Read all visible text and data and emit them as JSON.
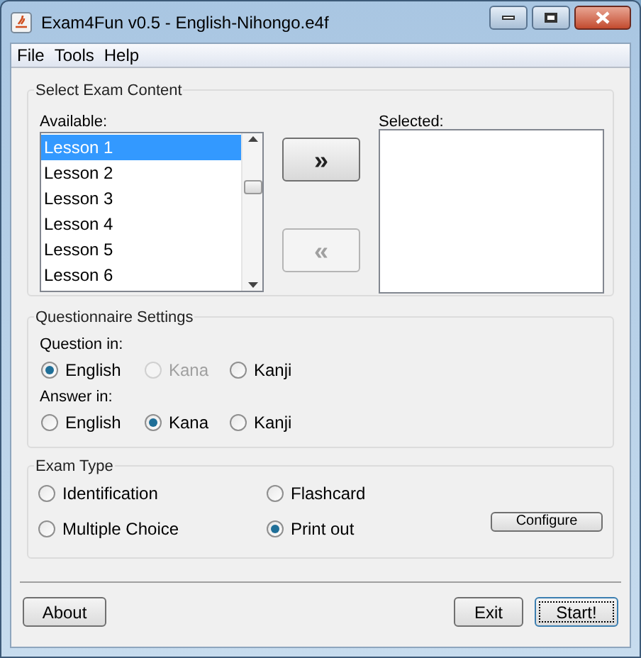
{
  "window": {
    "title": "Exam4Fun v0.5 - English-Nihongo.e4f"
  },
  "menu": [
    "File",
    "Tools",
    "Help"
  ],
  "content": {
    "title": "Select Exam Content",
    "available_label": "Available:",
    "selected_label": "Selected:",
    "available": [
      {
        "label": "Lesson 1",
        "selected": true
      },
      {
        "label": "Lesson 2",
        "selected": false
      },
      {
        "label": "Lesson 3",
        "selected": false
      },
      {
        "label": "Lesson 4",
        "selected": false
      },
      {
        "label": "Lesson 5",
        "selected": false
      },
      {
        "label": "Lesson 6",
        "selected": false
      }
    ],
    "add_button": {
      "label": "»",
      "disabled": false
    },
    "remove_button": {
      "label": "«",
      "disabled": true
    }
  },
  "questionnaire": {
    "title": "Questionnaire Settings",
    "groups": [
      {
        "label": "Question in:",
        "options": [
          {
            "label": "English",
            "selected": true,
            "disabled": false
          },
          {
            "label": "Kana",
            "selected": false,
            "disabled": true
          },
          {
            "label": "Kanji",
            "selected": false,
            "disabled": false
          }
        ]
      },
      {
        "label": "Answer in:",
        "options": [
          {
            "label": "English",
            "selected": false,
            "disabled": false
          },
          {
            "label": "Kana",
            "selected": true,
            "disabled": false
          },
          {
            "label": "Kanji",
            "selected": false,
            "disabled": false
          }
        ]
      }
    ]
  },
  "exam_type": {
    "title": "Exam Type",
    "options": [
      {
        "label": "Identification",
        "selected": false
      },
      {
        "label": "Flashcard",
        "selected": false
      },
      {
        "label": "Multiple Choice",
        "selected": false
      },
      {
        "label": "Print out",
        "selected": true
      }
    ],
    "configure": "Configure"
  },
  "buttons": [
    {
      "label": "About",
      "focused": false
    },
    {
      "label": "Exit",
      "focused": false
    },
    {
      "label": "Start!",
      "focused": true
    }
  ]
}
